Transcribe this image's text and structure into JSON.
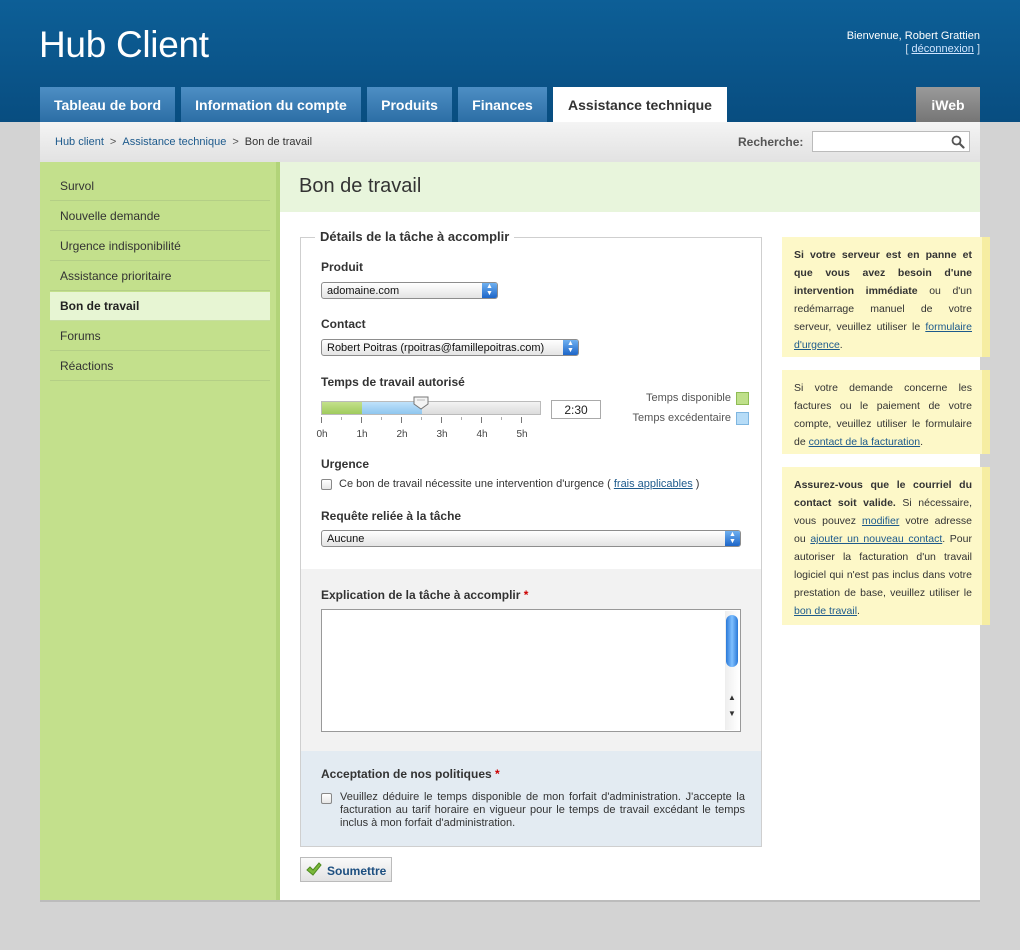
{
  "header": {
    "logo": "Hub Client",
    "welcome": "Bienvenue, Robert Grattien",
    "logout_open": "[",
    "logout": "déconnexion",
    "logout_close": "]"
  },
  "tabs": [
    {
      "label": "Tableau de bord"
    },
    {
      "label": "Information du compte"
    },
    {
      "label": "Produits"
    },
    {
      "label": "Finances"
    },
    {
      "label": "Assistance technique"
    },
    {
      "label": "iWeb"
    }
  ],
  "breadcrumb": {
    "items": [
      "Hub client",
      "Assistance technique",
      "Bon de travail"
    ],
    "separator": ">"
  },
  "search": {
    "label": "Recherche:",
    "value": ""
  },
  "sidebar": {
    "items": [
      {
        "label": "Survol"
      },
      {
        "label": "Nouvelle demande"
      },
      {
        "label": "Urgence indisponibilité"
      },
      {
        "label": "Assistance prioritaire"
      },
      {
        "label": "Bon de travail"
      },
      {
        "label": "Forums"
      },
      {
        "label": "Réactions"
      }
    ]
  },
  "page": {
    "title": "Bon de travail"
  },
  "form": {
    "legend": "Détails de la tâche à accomplir",
    "product_label": "Produit",
    "product_value": "adomaine.com",
    "contact_label": "Contact",
    "contact_value": "Robert Poitras (rpoitras@famillepoitras.com)",
    "time_label": "Temps de travail autorisé",
    "time_value": "2:30",
    "time_ticks": [
      "0h",
      "1h",
      "2h",
      "3h",
      "4h",
      "5h"
    ],
    "slider": {
      "max_hours": 5.5,
      "available_hours": 1,
      "value_hours": 2.5
    },
    "legend_available": "Temps disponible",
    "legend_excess": "Temps excédentaire",
    "urgency_label": "Urgence",
    "urgency_text": "Ce bon de travail nécessite une intervention d'urgence (",
    "urgency_link": "frais applicables",
    "urgency_close": ")",
    "request_label": "Requête reliée à la tâche",
    "request_value": "Aucune",
    "explanation_label": "Explication de la tâche à accomplir",
    "required_mark": "*",
    "explanation_value": "",
    "policy_label": "Acceptation de nos politiques",
    "policy_text": "Veuillez déduire le temps disponible de mon forfait d'administration. J'accepte la facturation au tarif horaire en vigueur pour le temps de travail excédant le temps inclus à mon forfait d'administration.",
    "submit_label": "Soumettre"
  },
  "notes": {
    "n1_bold": "Si votre serveur est en panne et que vous avez besoin d'une intervention immédiate",
    "n1_text": " ou d'un redémarrage manuel de votre serveur, veuillez utiliser le ",
    "n1_link": "formulaire d'urgence",
    "n1_end": ".",
    "n2_text": "Si votre demande concerne les factures ou le paiement de votre compte, veuillez utiliser le formulaire de ",
    "n2_link": "contact de la facturation",
    "n2_end": ".",
    "n3_bold": "Assurez-vous que le courriel du contact soit valide.",
    "n3_a": " Si nécessaire, vous pouvez ",
    "n3_link1": "modifier",
    "n3_b": " votre adresse ou ",
    "n3_link2": "ajouter un nouveau contact",
    "n3_c": ". Pour autoriser la facturation d'un travail logiciel qui n'est pas inclus dans votre prestation de base, veuillez utiliser le ",
    "n3_link3": "bon de travail",
    "n3_end": "."
  },
  "colors": {
    "header_blue": "#0b5a91",
    "sidebar_green": "#c3e08c",
    "available_green": "#a9d26b",
    "excess_blue": "#a3d2f5",
    "note_yellow": "#fdf8c8"
  }
}
